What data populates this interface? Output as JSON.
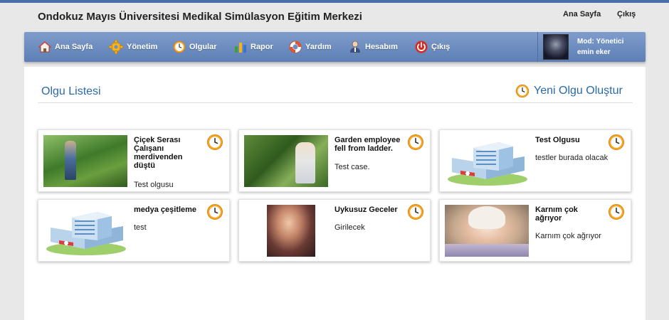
{
  "header": {
    "title": "Ondokuz Mayıs Üniversitesi Medikal Simülasyon Eğitim Merkezi",
    "links": [
      "Ana Sayfa",
      "Çıkış"
    ]
  },
  "nav": {
    "items": [
      {
        "label": "Ana Sayfa",
        "icon": "home-icon"
      },
      {
        "label": "Yönetim",
        "icon": "gear-icon"
      },
      {
        "label": "Olgular",
        "icon": "clock-icon"
      },
      {
        "label": "Rapor",
        "icon": "bar-chart-icon"
      },
      {
        "label": "Yardım",
        "icon": "lifebuoy-icon"
      },
      {
        "label": "Hesabım",
        "icon": "user-icon"
      },
      {
        "label": "Çıkış",
        "icon": "power-icon"
      }
    ],
    "user": {
      "role": "Mod: Yönetici",
      "name": "emin eker"
    }
  },
  "main": {
    "title": "Olgu Listesi",
    "new_case_label": "Yeni Olgu Oluştur",
    "cards": [
      {
        "title": "Çiçek Serası Çalışanı merdivenden düştü",
        "description": "Test olgusu",
        "image": "greenhouse-worker-photo"
      },
      {
        "title": "Garden employee fell from ladder.",
        "description": "Test case.",
        "image": "garden-photo"
      },
      {
        "title": "Test Olgusu",
        "description": "testler burada olacak",
        "image": "hospital-building-icon"
      },
      {
        "title": "medya çeşitleme",
        "description": "test",
        "image": "hospital-building-icon"
      },
      {
        "title": "Uykusuz Geceler",
        "description": "Girilecek",
        "image": "couple-photo"
      },
      {
        "title": "Karnım çok ağrıyor",
        "description": "Karnım çok ağrıyor",
        "image": "elderly-woman-photo"
      }
    ]
  },
  "colors": {
    "nav_bg": "#6d8ec2",
    "title_blue": "#2b6aa8",
    "clock_orange": "#f0a020"
  }
}
